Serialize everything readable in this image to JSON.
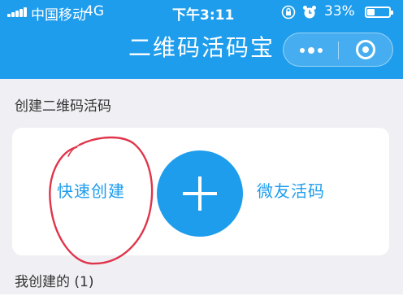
{
  "status_bar": {
    "carrier": "中国移动",
    "network": "4G",
    "time": "下午3:11",
    "battery_percent": "33%",
    "battery_level": 0.33
  },
  "nav": {
    "title": "二维码活码宝"
  },
  "create_section": {
    "title": "创建二维码活码",
    "quick_create_label": "快速创建",
    "wechat_code_label": "微友活码"
  },
  "my_created": {
    "title": "我创建的 (1)"
  },
  "colors": {
    "brand_blue": "#1e9ded",
    "annotation_red": "#e0344a"
  }
}
